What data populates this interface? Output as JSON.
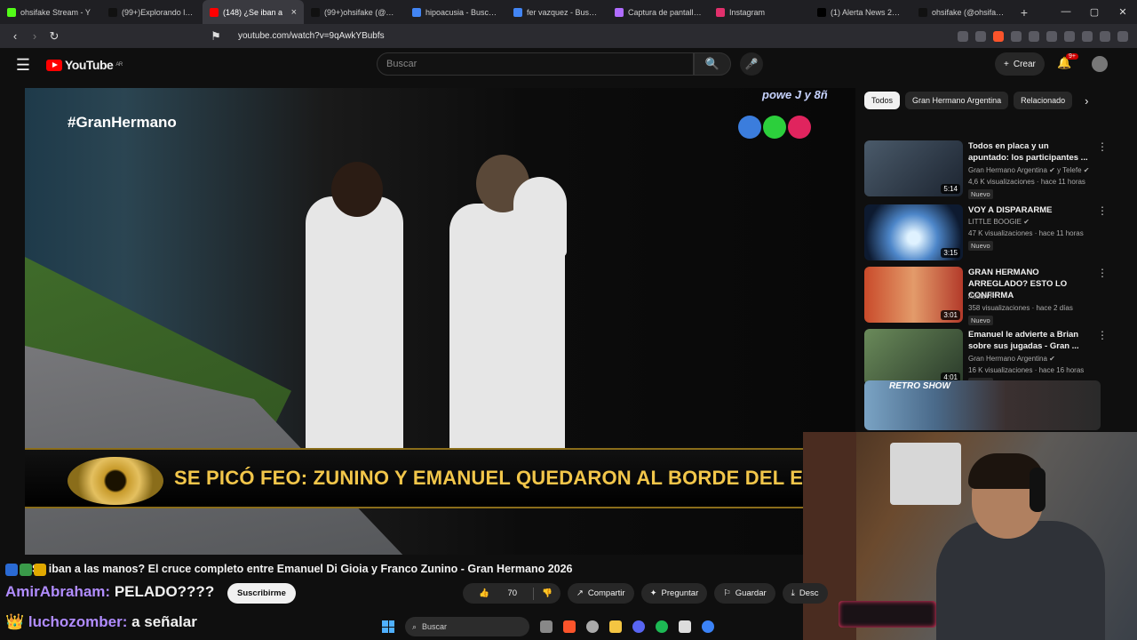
{
  "browser": {
    "tabs": [
      {
        "title": "ohsifake Stream - Y",
        "color": "#53fc18",
        "active": false
      },
      {
        "title": "(99+)Explorando la Cu",
        "color": "#111111",
        "active": false
      },
      {
        "title": "(148) ¿Se iban a",
        "color": "#ff0000",
        "active": true
      },
      {
        "title": "(99+)ohsifake (@ohsif",
        "color": "#111111",
        "active": false
      },
      {
        "title": "hipoacusia - Buscar co",
        "color": "#4285f4",
        "active": false
      },
      {
        "title": "fer vazquez - Buscar co",
        "color": "#4285f4",
        "active": false
      },
      {
        "title": "Captura de pantalla pa",
        "color": "#b06cff",
        "active": false
      },
      {
        "title": "Instagram",
        "color": "#e1306c",
        "active": false
      },
      {
        "title": "(1) Alerta News 24 en",
        "color": "#000000",
        "active": false
      },
      {
        "title": "ohsifake (@ohsifake) |",
        "color": "#111111",
        "active": false
      }
    ],
    "new_tab": "+",
    "url": "youtube.com/watch?v=9qAwkYBubfs"
  },
  "youtube": {
    "logo_text": "YouTube",
    "region": "AR",
    "search_placeholder": "Buscar",
    "create_label": "Crear",
    "notif_count": "9+"
  },
  "video": {
    "hashtag": "#GranHermano",
    "corner_text": "powe  J  y 8ñ",
    "banner": "SE PICÓ FEO: ZUNINO Y EMANUEL QUEDARON AL BORDE DEL ESCÁNDALO",
    "title": "Se iban a las manos? El cruce completo entre Emanuel Di Gioia y Franco Zunino - Gran Hermano 2026",
    "subscribe_label": "Suscribirme",
    "likes": "70",
    "actions": {
      "share": "Compartir",
      "ask": "Preguntar",
      "save": "Guardar",
      "download": "Descargar"
    }
  },
  "chips": [
    "Todos",
    "Gran Hermano Argentina",
    "Relacionado"
  ],
  "recommendations": [
    {
      "title": "Todos en placa y un apuntado: los participantes ...",
      "channel": "Gran Hermano Argentina ✔ y Telefe ✔",
      "meta": "4,6 K visualizaciones · hace 11 horas",
      "duration": "5:14",
      "badge": "Nuevo",
      "thumb": "linear-gradient(135deg,#4a5a6a,#1c2430)"
    },
    {
      "title": "VOY A DISPARARME",
      "channel": "LITTLE BOOGIE ✔",
      "meta": "47 K visualizaciones · hace 11 horas",
      "duration": "3:15",
      "badge": "Nuevo",
      "thumb": "radial-gradient(circle at 50% 60%,#dff2ff 10%,#4d86c9 40%,#0d1a30 80%)"
    },
    {
      "title": "GRAN HERMANO ARREGLADO? ESTO LO CONFIRMA",
      "channel": "Austin P",
      "meta": "358 visualizaciones · hace 2 días",
      "duration": "3:01",
      "badge": "Nuevo",
      "thumb": "linear-gradient(90deg,#c94a2a,#e39b6a 50%,#b33a2a)"
    },
    {
      "title": "Emanuel le advierte a Brian sobre sus jugadas - Gran ...",
      "channel": "Gran Hermano Argentina ✔",
      "meta": "16 K visualizaciones · hace 16 horas",
      "duration": "4:01",
      "badge": "Nuevo",
      "thumb": "linear-gradient(135deg,#6a8a5a,#2a3a2a)"
    }
  ],
  "retro_card": {
    "label": "RETRO SHOW"
  },
  "chat": [
    {
      "user": "AmirAbraham:",
      "msg": "PELADO????"
    },
    {
      "user": "luchozomber:",
      "msg": "a señalar"
    }
  ],
  "taskbar": {
    "search_label": "Buscar"
  }
}
